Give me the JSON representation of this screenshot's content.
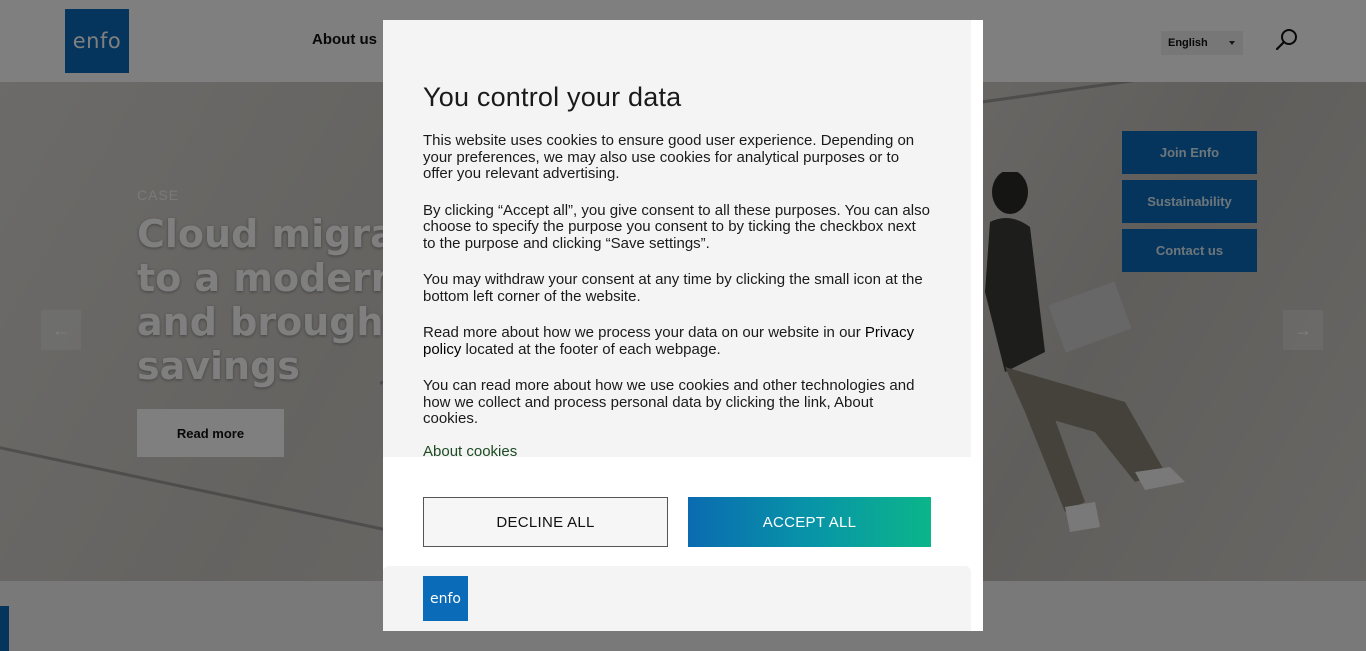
{
  "header": {
    "logo_text": "enfo",
    "nav_about": "About us",
    "language": "English"
  },
  "hero": {
    "case_label": "CASE",
    "title": "Cloud migration to a modern ... and brought savings",
    "title_lines": [
      "Cloud migra",
      "to a modern",
      "and brought",
      "savings"
    ],
    "read_more": "Read more",
    "side_buttons": [
      "Join Enfo",
      "Sustainability",
      "Contact us"
    ],
    "prev_arrow": "←",
    "next_arrow": "→"
  },
  "cookie_modal": {
    "title": "You control your data",
    "paragraphs": [
      "This website uses cookies to ensure good user experience. Depending on your preferences, we may also use cookies for analytical purposes or to offer you relevant advertising.",
      "By clicking “Accept all”, you give consent to all these purposes. You can also choose to specify the purpose you consent to by ticking the checkbox next to the purpose and clicking “Save settings”.",
      "You may withdraw your consent at any time by clicking the small icon at the bottom left corner of the website."
    ],
    "privacy_prefix": "Read more about how we process your data on our website in our",
    "privacy_link": "Privacy policy",
    "privacy_suffix": "located at the footer of each webpage.",
    "cookies_paragraph": "You can read more about how we use cookies and other technologies and how we collect and process personal data by clicking the link, About cookies.",
    "about_cookies_link": "About cookies",
    "decline_label": "DECLINE ALL",
    "accept_label": "ACCEPT ALL",
    "footer_logo_text": "enfo"
  },
  "colors": {
    "brand_blue": "#0a6bb8",
    "accept_gradient_start": "#0a6bb0",
    "accept_gradient_end": "#0bb58a",
    "link_green": "#1c4b24"
  },
  "icons": {
    "search": "search-icon",
    "language_dropdown": "chevron-down-icon",
    "prev": "arrow-left-icon",
    "next": "arrow-right-icon"
  }
}
